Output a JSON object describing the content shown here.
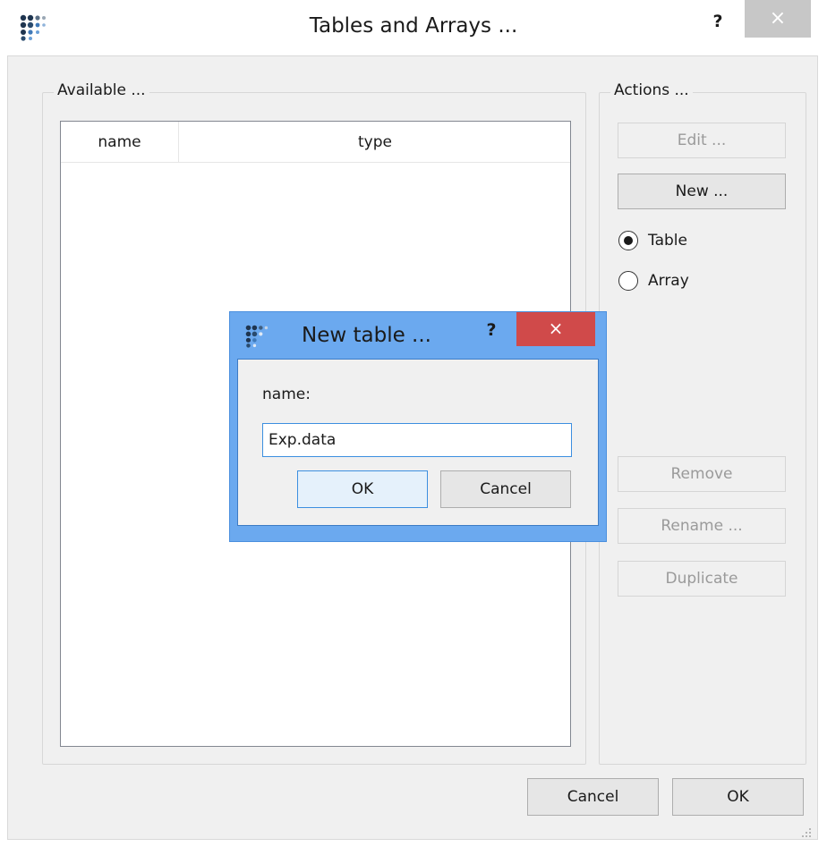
{
  "window": {
    "title": "Tables and Arrays ...",
    "help_label": "?",
    "close_label": "×"
  },
  "available": {
    "group_title": "Available ...",
    "columns": [
      "name",
      "type"
    ],
    "rows": []
  },
  "actions": {
    "group_title": "Actions ...",
    "edit_label": "Edit ...",
    "new_label": "New ...",
    "radio_table_label": "Table",
    "radio_array_label": "Array",
    "selected_type": "Table",
    "remove_label": "Remove",
    "rename_label": "Rename ...",
    "duplicate_label": "Duplicate"
  },
  "footer": {
    "cancel_label": "Cancel",
    "ok_label": "OK"
  },
  "dialog": {
    "title": "New table ...",
    "help_label": "?",
    "close_label": "×",
    "field_label": "name:",
    "field_value": "Exp.data",
    "ok_label": "OK",
    "cancel_label": "Cancel"
  },
  "colors": {
    "dialog_frame": "#6ba9ef",
    "dialog_close": "#d04a4a",
    "focus_border": "#3c8fe0",
    "disabled_text": "#9a9a9a"
  },
  "icons": {
    "app": "app-dots-icon",
    "close": "close-icon",
    "help": "help-icon",
    "resize": "resize-grip-icon"
  }
}
